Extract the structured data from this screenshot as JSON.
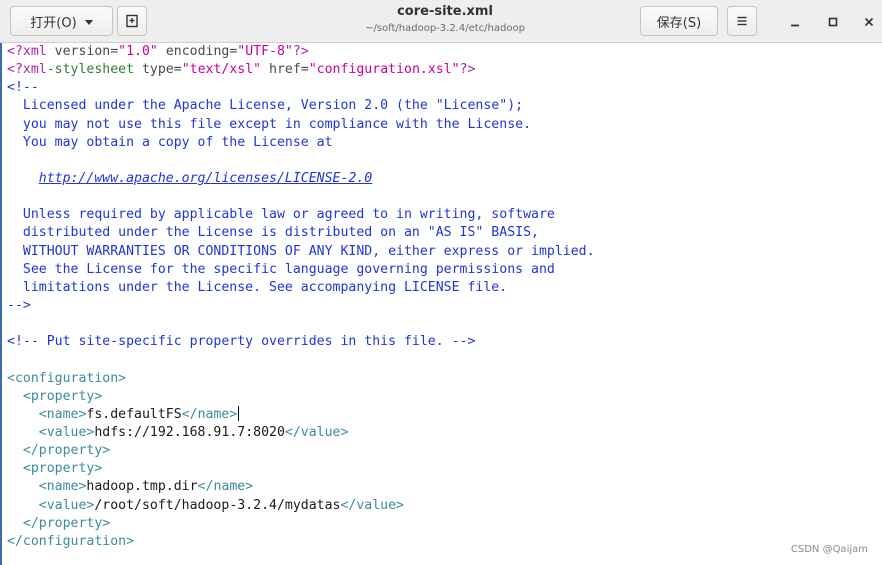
{
  "toolbar": {
    "open_label": "打开(O)",
    "save_label": "保存(S)"
  },
  "window": {
    "title": "core-site.xml",
    "path": "~/soft/hadoop-3.2.4/etc/hadoop"
  },
  "icons": {
    "new_document": "new-document-icon",
    "menu": "hamburger-menu-icon",
    "minimize": "minimize-icon",
    "maximize": "maximize-icon",
    "close": "close-icon"
  },
  "colors": {
    "processing_instruction": "#a625a4",
    "tag": "#3a8c9e",
    "string": "#cc0099",
    "comment": "#1f36d6",
    "text": "#1a1a1a"
  },
  "editor": {
    "xml_decl": {
      "open": "<?xml",
      "attrs": " version=",
      "v1": "\"1.0\"",
      "attrs2": " encoding=",
      "v2": "\"UTF-8\"",
      "close": "?>"
    },
    "stylesheet": {
      "open": "<?xml",
      "kw": "-stylesheet",
      "a1": " type=",
      "v1": "\"text/xsl\"",
      "a2": " href=",
      "v2": "\"configuration.xsl\"",
      "close": "?>"
    },
    "comment_open": "<!--",
    "license": [
      "  Licensed under the Apache License, Version 2.0 (the \"License\");",
      "  you may not use this file except in compliance with the License.",
      "  You may obtain a copy of the License at"
    ],
    "license_url": "http://www.apache.org/licenses/LICENSE-2.0",
    "license2": [
      "  Unless required by applicable law or agreed to in writing, software",
      "  distributed under the License is distributed on an \"AS IS\" BASIS,",
      "  WITHOUT WARRANTIES OR CONDITIONS OF ANY KIND, either express or implied.",
      "  See the License for the specific language governing permissions and",
      "  limitations under the License. See accompanying LICENSE file."
    ],
    "comment_close": "-->",
    "override_comment": "<!-- Put site-specific property overrides in this file. -->",
    "config_open": "<configuration>",
    "config_close": "</configuration>",
    "property_open": "<property>",
    "property_close": "</property>",
    "name_open": "<name>",
    "name_close": "</name>",
    "value_open": "<value>",
    "value_close": "</value>",
    "properties": [
      {
        "name": "fs.defaultFS",
        "value": "hdfs://192.168.91.7:8020"
      },
      {
        "name": "hadoop.tmp.dir",
        "value": "/root/soft/hadoop-3.2.4/mydatas"
      }
    ]
  },
  "watermark": "CSDN @Qaijam"
}
